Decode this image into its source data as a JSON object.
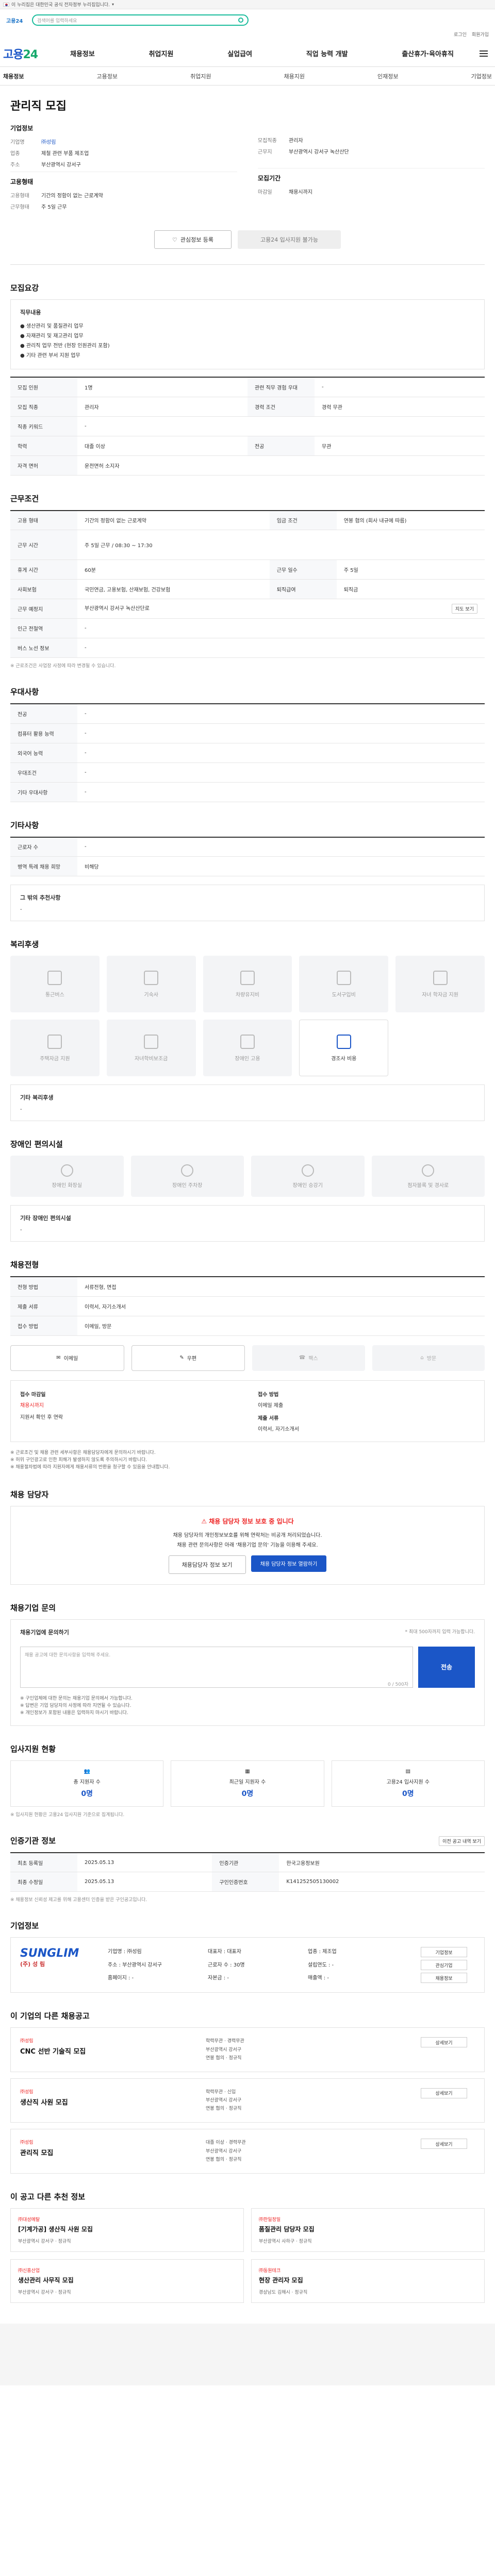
{
  "gov_banner": "이 누리집은 대한민국 공식 전자정부 누리집입니다.",
  "search": {
    "placeholder": "검색어를 입력하세요"
  },
  "mini_logo": "고용24",
  "util": [
    "로그인",
    "회원가입"
  ],
  "brand": {
    "a": "고용",
    "b": "24"
  },
  "gnb": [
    "채용정보",
    "취업지원",
    "실업급여",
    "직업 능력 개발",
    "출산휴가·육아휴직"
  ],
  "sub_nav": [
    "채용정보",
    "고용정보",
    "취업지원",
    "채용지원",
    "인재정보",
    "기업정보"
  ],
  "job": {
    "title": "관리직 모집",
    "company_head": "기업정보",
    "company_rows": [
      {
        "k": "기업명",
        "v": "㈜성림"
      },
      {
        "k": "업종",
        "v": "제철 관련 부품 제조업"
      },
      {
        "k": "주소",
        "v": "부산광역시 강서구"
      }
    ],
    "right_rows": [
      {
        "k": "모집직종",
        "v": "관리자"
      },
      {
        "k": "근무지",
        "v": "부산광역시 강서구 녹산산단"
      }
    ],
    "cond_head": "고용형태",
    "cond_rows": [
      {
        "k": "고용형태",
        "v": "기간의 정함이 없는 근로계약"
      },
      {
        "k": "근무형태",
        "v": "주 5일 근무"
      }
    ],
    "cond_right_head": "모집기간",
    "cond_right_rows": [
      {
        "k": "마감일",
        "v": "채용시까지"
      }
    ],
    "btn_save": "관심정보 등록",
    "btn_apply": "고용24 입사지원 불가능"
  },
  "sections": {
    "recruit": "모집요강",
    "work": "근무조건",
    "prefer": "우대사항",
    "etc": "기타사항",
    "welfare": "복리후생",
    "disabled": "장애인 편의시설",
    "apply_method": "채용전형",
    "contact": "채용 담당자",
    "inquiry": "채용기업 문의",
    "reply": "입사지원 현황",
    "history": "인증기관 정보",
    "biz": "기업정보",
    "other_jobs": "이 기업의 다른 채용공고",
    "recommend": "이 공고 다른 추천 정보"
  },
  "duties": {
    "head": "직무내용",
    "items": [
      "생산관리 및 품질관리 업무",
      "자재관리 및 재고관리 업무",
      "관리직 업무 전반 (현장 인원관리 포함)",
      "기타 관련 부서 지원 업무"
    ]
  },
  "recruit_table": [
    [
      "모집 인원",
      "1명",
      "관련 직무 경험 우대",
      "-"
    ],
    [
      "모집 직종",
      "관리자",
      "경력 조건",
      "경력 무관"
    ],
    [
      "직종 키워드",
      "-",
      "",
      ""
    ],
    [
      "학력",
      "대졸 이상",
      "전공",
      "무관"
    ],
    [
      "자격 면허",
      "운전면허 소지자",
      "",
      ""
    ]
  ],
  "work_table": [
    [
      "고용 형태",
      "기간의 정함이 없는 근로계약",
      "임금 조건",
      "연봉 협의 (회사 내규에 따름)"
    ],
    [
      "근무 시간",
      "주 5일 근무 / 08:30 ~ 17:30",
      "",
      ""
    ],
    [
      "휴게 시간",
      "60분",
      "근무 일수",
      "주 5일"
    ],
    [
      "사회보험",
      "국민연금, 고용보험, 산재보험, 건강보험",
      "퇴직급여",
      "퇴직금"
    ],
    [
      "근무 예정지",
      "부산광역시 강서구 녹산산단로",
      "",
      ""
    ],
    [
      "인근 전철역",
      "-",
      "",
      ""
    ],
    [
      "버스 노선 정보",
      "-",
      "",
      ""
    ]
  ],
  "work_note": "※ 근로조건은 사업장 사정에 따라 변경될 수 있습니다.",
  "map_btn": "지도 보기",
  "prefer_table": [
    [
      "전공",
      "-"
    ],
    [
      "컴퓨터 활용 능력",
      "-"
    ],
    [
      "외국어 능력",
      "-"
    ],
    [
      "우대조건",
      "-"
    ],
    [
      "기타 우대사항",
      "-"
    ]
  ],
  "etc_table": [
    [
      "근로자 수",
      "-"
    ],
    [
      "병역 특례 채용 희망",
      "비해당"
    ]
  ],
  "etc_other": {
    "head": "그 밖의 추천사항",
    "value": "-"
  },
  "welfare": [
    {
      "label": "통근버스",
      "on": false
    },
    {
      "label": "기숙사",
      "on": false
    },
    {
      "label": "차량유지비",
      "on": false
    },
    {
      "label": "도서구입비",
      "on": false
    },
    {
      "label": "자녀 학자금 지원",
      "on": false
    },
    {
      "label": "주택자금 지원",
      "on": false
    },
    {
      "label": "자녀학비보조금",
      "on": false
    },
    {
      "label": "장애인 고용",
      "on": false
    },
    {
      "label": "경조사 비용",
      "on": true
    }
  ],
  "welfare_other": {
    "head": "기타 복리후생",
    "value": "-"
  },
  "disabled": [
    {
      "label": "장애인 화장실"
    },
    {
      "label": "장애인 주차장"
    },
    {
      "label": "장애인 승강기"
    },
    {
      "label": "점자블록 및 경사로"
    }
  ],
  "disabled_other": {
    "head": "기타 장애인 편의시설",
    "value": "-"
  },
  "apply_table": [
    [
      "전형 방법",
      "서류전형, 면접"
    ],
    [
      "제출 서류",
      "이력서, 자기소개서"
    ],
    [
      "접수 방법",
      "이메일, 방문"
    ]
  ],
  "apply_methods": [
    {
      "label": "이메일",
      "on": true
    },
    {
      "label": "우편",
      "on": true
    },
    {
      "label": "팩스",
      "on": false
    },
    {
      "label": "방문",
      "on": false
    }
  ],
  "apply_detail": {
    "left_head": "접수 마감일",
    "left_value": "채용시까지",
    "left_value2": "지원서 확인 후 연락",
    "right_head": "접수 방법",
    "right_value": "이메일 제출",
    "right_head2": "제출 서류",
    "right_value2": "이력서, 자기소개서"
  },
  "apply_notes": [
    "※ 근로조건 및 채용 관련 세부사항은 채용담당자에게 문의하시기 바랍니다.",
    "※ 허위 구인광고로 인한 피해가 발생하지 않도록 주의하시기 바랍니다.",
    "※ 채용절차법에 따라 지원자에게 채용서류의 반환을 청구할 수 있음을 안내합니다."
  ],
  "contact": {
    "warn": "채용 담당자 정보 보호 중 입니다",
    "text1": "채용 담당자의 개인정보보호를 위해 연락처는 비공개 처리되었습니다.",
    "text2": "채용 관련 문의사항은 아래 '채용기업 문의' 기능을 이용해 주세요.",
    "btn1": "채용담당자 정보 보기",
    "btn2": "채용 담당자 정보 열람하기"
  },
  "inquiry": {
    "head": "채용기업에 문의하기",
    "limit": "* 최대 500자까지 입력 가능합니다.",
    "placeholder": "채용 공고에 대한 문의사항을 입력해 주세요.",
    "count": "0 / 500자",
    "send": "전송",
    "notes": [
      "※ 구인업체에 대한 문의는 채용기업 문의에서 가능합니다.",
      "※ 답변은 기업 담당자의 사정에 따라 지연될 수 있습니다.",
      "※ 개인정보가 포함된 내용은 입력하지 마시기 바랍니다."
    ]
  },
  "reply": [
    {
      "label": "총 지원자 수",
      "num": "0명"
    },
    {
      "label": "최근일 지원자 수",
      "num": "0명"
    },
    {
      "label": "고용24 입사지원 수",
      "num": "0명"
    }
  ],
  "reply_note": "※ 입사지원 현황은 고용24 입사지원 기준으로 집계됩니다.",
  "history_btn": "이전 공고 내역 보기",
  "history_table": [
    [
      "최초 등록일",
      "2025.05.13",
      "인증기관",
      "한국고용정보원"
    ],
    [
      "최종 수정일",
      "2025.05.13",
      "구인인증번호",
      "K141252505130002"
    ]
  ],
  "history_note": "※ 채용정보 신뢰성 제고를 위해 고용센터 인증을 받은 구인공고입니다.",
  "biz": {
    "logo": "SUNGLIM",
    "logo_sub": "(주) 성 림",
    "info": [
      "기업명 : ㈜성림",
      "대표자 : 대표자",
      "업종 : 제조업",
      "주소 : 부산광역시 강서구",
      "근로자 수 : 30명",
      "설립연도 : -",
      "홈페이지 : -",
      "자본금 : -",
      "매출액 : -"
    ],
    "btns": [
      "기업정보",
      "관심기업",
      "채용정보"
    ]
  },
  "other_jobs": [
    {
      "co": "㈜성림",
      "title": "CNC 선반 기술직 모집",
      "meta1": "학력무관 · 경력무관",
      "meta2": "부산광역시 강서구",
      "meta3": "연봉 협의 · 정규직",
      "btn": "상세보기"
    },
    {
      "co": "㈜성림",
      "title": "생산직 사원 모집",
      "meta1": "학력무관 · 신입",
      "meta2": "부산광역시 강서구",
      "meta3": "연봉 협의 · 정규직",
      "btn": "상세보기"
    },
    {
      "co": "㈜성림",
      "title": "관리직 모집",
      "meta1": "대졸 이상 · 경력무관",
      "meta2": "부산광역시 강서구",
      "meta3": "연봉 협의 · 정규직",
      "btn": "상세보기"
    }
  ],
  "recommend": [
    {
      "co": "㈜대성메탈",
      "title": "[기계가공] 생산직 사원 모집",
      "meta": "부산광역시 강서구 · 정규직"
    },
    {
      "co": "㈜한일정밀",
      "title": "품질관리 담당자 모집",
      "meta": "부산광역시 사하구 · 정규직"
    },
    {
      "co": "㈜신흥산업",
      "title": "생산관리 사무직 모집",
      "meta": "부산광역시 강서구 · 정규직"
    },
    {
      "co": "㈜동원테크",
      "title": "현장 관리자 모집",
      "meta": "경상남도 김해시 · 정규직"
    }
  ]
}
